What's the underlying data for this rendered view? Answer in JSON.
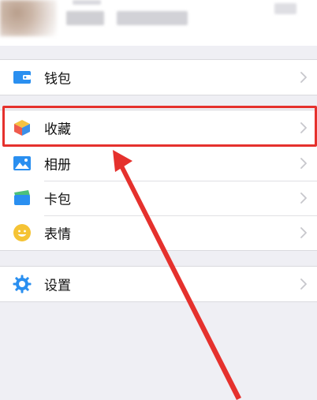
{
  "menu": {
    "items": [
      {
        "key": "wallet",
        "label": "钱包",
        "icon": "wallet-icon"
      },
      {
        "key": "favorites",
        "label": "收藏",
        "icon": "cube-icon"
      },
      {
        "key": "album",
        "label": "相册",
        "icon": "photo-icon"
      },
      {
        "key": "cards",
        "label": "卡包",
        "icon": "card-icon"
      },
      {
        "key": "stickers",
        "label": "表情",
        "icon": "smiley-icon"
      },
      {
        "key": "settings",
        "label": "设置",
        "icon": "gear-icon"
      }
    ]
  },
  "colors": {
    "background": "#efeff4",
    "highlight": "#e5312d",
    "icon_blue": "#2a8ff0"
  }
}
